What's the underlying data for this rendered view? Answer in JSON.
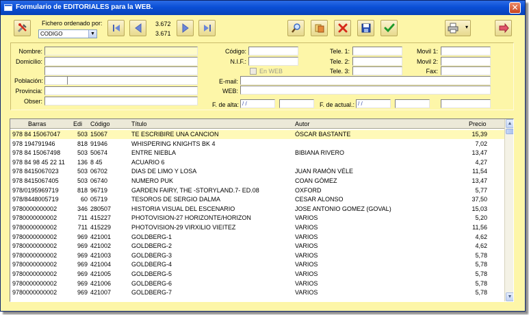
{
  "window": {
    "title": "Formulario de EDITORIALES para la WEB.",
    "close_glyph": "✕"
  },
  "toolbar": {
    "sort_label": "Fichero ordenado por:",
    "sort_value": "CODIGO",
    "sort_arrow": "▼",
    "total_count": "3.672",
    "current_count": "3.671",
    "print_arrow": "▾",
    "icons": {
      "tools": "tools-icon",
      "first": "first-record-icon",
      "prev": "previous-record-icon",
      "next": "next-record-icon",
      "last": "last-record-icon",
      "search": "search-icon",
      "copy": "copy-icon",
      "delete": "delete-icon",
      "save": "save-icon",
      "accept": "checkmark-icon",
      "print": "printer-icon",
      "exit": "exit-icon"
    }
  },
  "form": {
    "labels": {
      "nombre": "Nombre:",
      "domicilio": "Domicilio:",
      "poblacion": "Población:",
      "provincia": "Provincia:",
      "obser": "Obser:",
      "codigo": "Código:",
      "nif": "N.I.F.:",
      "en_web": "En WEB",
      "email": "E-mail:",
      "web": "WEB:",
      "f_alta": "F. de alta:",
      "tele1": "Tele. 1:",
      "tele2": "Tele. 2:",
      "tele3": "Tele. 3:",
      "f_actual": "F. de actual.:",
      "movil1": "Movil 1:",
      "movil2": "Movil 2:",
      "fax": "Fax:"
    },
    "values": {
      "f_alta": "/ /",
      "f_actual": "/ /"
    }
  },
  "table": {
    "columns": [
      "Barras",
      "Edi",
      "Código",
      "Título",
      "Autor",
      "Precio"
    ],
    "rows": [
      [
        "978  84 15067047",
        "503",
        "15067",
        "TE ESCRIBIRE UNA CANCION",
        "ÓSCAR BASTANTE",
        "15,39"
      ],
      [
        "978 194791946",
        "818",
        "91946",
        "WHISPERING KNIGHTS  BK 4",
        "",
        "7,02"
      ],
      [
        "978 84 15067498",
        "503",
        "50674",
        "ENTRE NIEBLA",
        "BIBIANA RIVERO",
        "13,47"
      ],
      [
        "978 84 98 45 22 11",
        "136",
        "8 45",
        "ACUARIO 6",
        "",
        "4,27"
      ],
      [
        "978 8415067023",
        "503",
        "06702",
        "DIAS DE LIMO Y LOSA",
        "JUAN RAMÓN VÉLE",
        "11,54"
      ],
      [
        "978 8415067405",
        "503",
        "06740",
        "NUMERO PUK",
        "COAN GÓMEZ",
        "13,47"
      ],
      [
        "978/0195969719",
        "818",
        "96719",
        "GARDEN FAIRY, THE -STORYLAND.7- ED.08",
        "OXFORD",
        "5,77"
      ],
      [
        "978/8448005719",
        "60",
        "05719",
        "TESOROS DE SERGIO DALMA",
        "CESAR ALONSO",
        "37,50"
      ],
      [
        "9780000000002",
        "346",
        "280507",
        "HISTORIA VISUAL DEL ESCENARIO",
        "JOSE ANTONIO GOMEZ (GOVAL)",
        "15,03"
      ],
      [
        "9780000000002",
        "711",
        "415227",
        "PHOTOVISION-27 HORIZONTE/HORIZON",
        " VARIOS",
        "5,20"
      ],
      [
        "9780000000002",
        "711",
        "415229",
        "PHOTOVISION-29 VIRXILIO VIEITEZ",
        " VARIOS",
        "11,56"
      ],
      [
        "9780000000002",
        "969",
        "421001",
        "GOLDBERG-1",
        " VARIOS",
        "4,62"
      ],
      [
        "9780000000002",
        "969",
        "421002",
        "GOLDBERG-2",
        " VARIOS",
        "4,62"
      ],
      [
        "9780000000002",
        "969",
        "421003",
        "GOLDBERG-3",
        " VARIOS",
        "5,78"
      ],
      [
        "9780000000002",
        "969",
        "421004",
        "GOLDBERG-4",
        " VARIOS",
        "5,78"
      ],
      [
        "9780000000002",
        "969",
        "421005",
        "GOLDBERG-5",
        " VARIOS",
        "5,78"
      ],
      [
        "9780000000002",
        "969",
        "421006",
        "GOLDBERG-6",
        " VARIOS",
        "5,78"
      ],
      [
        "9780000000002",
        "969",
        "421007",
        "GOLDBERG-7",
        " VARIOS",
        "5,78"
      ]
    ],
    "scroll_up": "▲",
    "scroll_down": "▼"
  }
}
